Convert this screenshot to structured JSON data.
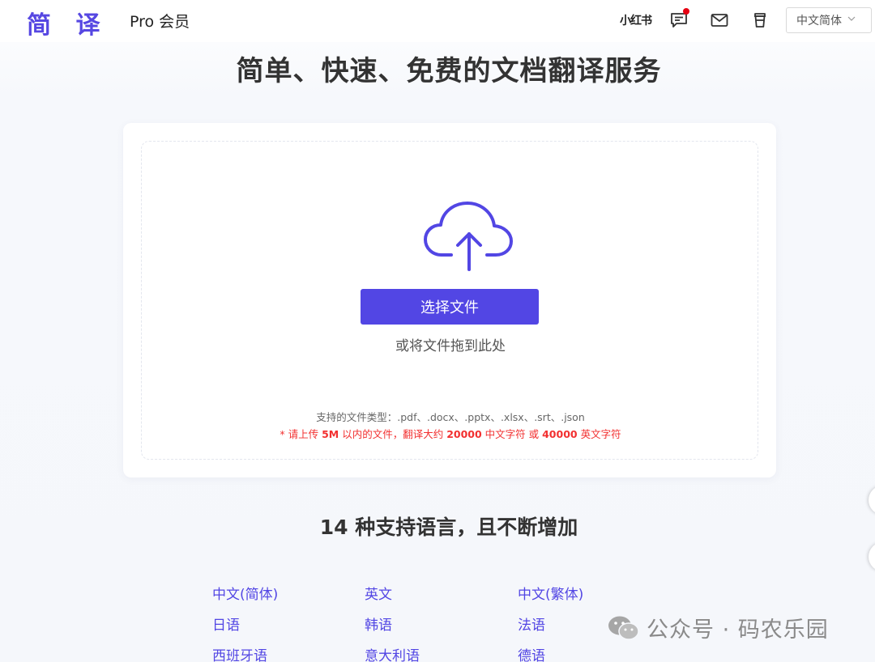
{
  "header": {
    "logo": "简 译",
    "pro_link": "Pro 会员",
    "xiaohongshu": "小红书",
    "language_selector": "中文简体",
    "icons": [
      "xiaohongshu-icon",
      "feedback-icon",
      "mail-icon",
      "cup-icon",
      "chevron-down-icon"
    ]
  },
  "headline": "简单、快速、免费的文档翻译服务",
  "upload": {
    "button_label": "选择文件",
    "drag_hint": "或将文件拖到此处",
    "file_types": "支持的文件类型：.pdf、.docx、.pptx、.xlsx、.srt、.json",
    "size_note_prefix": "* 请上传 ",
    "size_note_size": "5M",
    "size_note_mid": " 以内的文件，翻译大约 ",
    "size_note_cn_count": "20000",
    "size_note_cn_label": " 中文字符 或 ",
    "size_note_en_count": "40000",
    "size_note_en_label": " 英文字符",
    "accent_color": "#5246e4",
    "warning_color": "#f23030"
  },
  "languages": {
    "title": "14 种支持语言，且不断增加",
    "items": [
      "中文(简体)",
      "英文",
      "中文(繁体)",
      "日语",
      "韩语",
      "法语",
      "西班牙语",
      "意大利语",
      "德语"
    ]
  },
  "watermark": "公众号 · 码农乐园"
}
